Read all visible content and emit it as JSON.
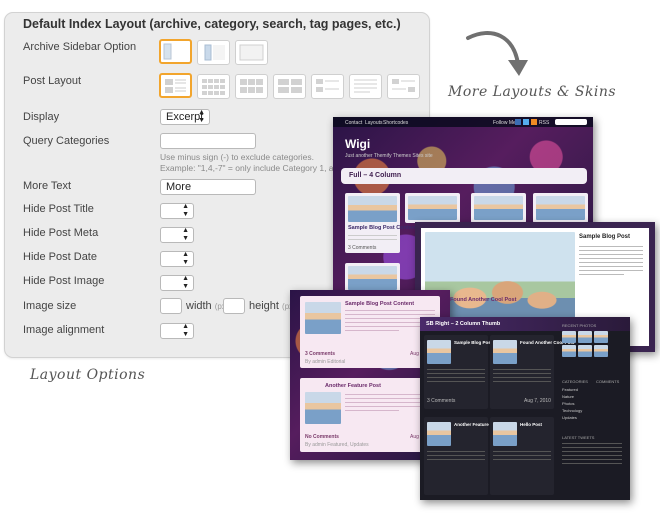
{
  "panel": {
    "title": "Default Index Layout (archive, category, search, tag pages, etc.)",
    "rows": {
      "archive_sidebar": "Archive Sidebar Option",
      "post_layout": "Post Layout",
      "display": "Display",
      "query_categories": "Query Categories",
      "more_text": "More Text",
      "hide_post_title": "Hide Post Title",
      "hide_post_meta": "Hide Post Meta",
      "hide_post_date": "Hide Post Date",
      "hide_post_image": "Hide Post Image",
      "image_size": "Image size",
      "image_alignment": "Image alignment"
    },
    "display_value": "Excerpt",
    "query_categories_value": "",
    "query_hint_1": "Use minus sign (-) to exclude categories.",
    "query_hint_2": "Example: \"1,4,-7\" = only include Category 1, and exclude Category 7",
    "more_text_value": "More",
    "width_label": "width",
    "height_label": "height",
    "unit_px": "(px)",
    "accent_color": "#f2a52d"
  },
  "captions": {
    "more_layouts": "More Layouts & Skins",
    "layout_options": "Layout Options"
  },
  "skins": {
    "wigi": {
      "nav": [
        "Contact",
        "Layouts",
        "Shortcodes"
      ],
      "follow": "Follow Me",
      "rss": "RSS",
      "logo": "Wigi",
      "tagline": "Just another Themify Themes Sites site",
      "section": "Full – 4 Column",
      "post_title": "Sample Blog Post Content",
      "comments": "3 Comments",
      "date": "Aug 7, 2010"
    },
    "feature": {
      "post_title": "Sample Blog Post"
    },
    "pink": {
      "post1_title": "Sample Blog Post Content",
      "post2_title": "Found Another Cool Post",
      "post3_title": "Another Feature Post",
      "comments": "3 Comments",
      "no_comments": "No Comments",
      "date": "Aug 7, 2010",
      "meta": "By admin  Editorial",
      "meta2": "By admin  Featured, Updates"
    },
    "dark": {
      "section": "SB Right – 2 Column Thumb",
      "post1_title": "Sample Blog Post Content",
      "post2_title": "Found Another Cool Post",
      "post3_title": "Another Feature Post",
      "post4_title": "Hello Post",
      "recent_photos": "RECENT PHOTOS",
      "categories": "CATEGORIES",
      "comments_heading": "COMMENTS",
      "latest_tweets": "LATEST TWEETS",
      "cat_items": [
        "Featured",
        "Nature",
        "Photos",
        "Technology",
        "Updates"
      ],
      "comments": "3 Comments",
      "date": "Aug 7, 2010"
    }
  }
}
